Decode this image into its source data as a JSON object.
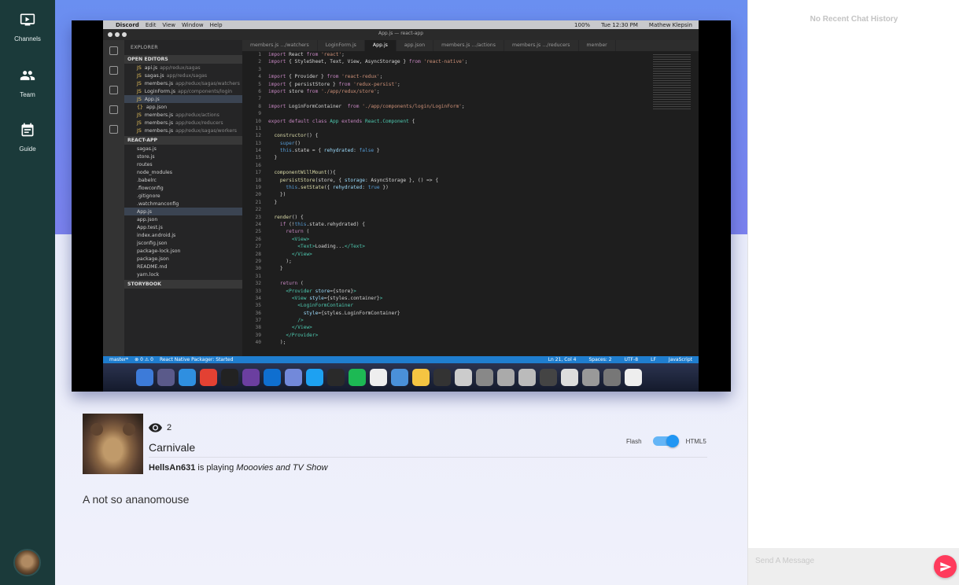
{
  "nav": {
    "items": [
      {
        "label": "Channels",
        "icon": "tv-icon"
      },
      {
        "label": "Team",
        "icon": "people-icon"
      },
      {
        "label": "Guide",
        "icon": "calendar-icon"
      }
    ]
  },
  "stream": {
    "screen": {
      "menubar": {
        "app": "Discord",
        "menus": [
          "Edit",
          "View",
          "Window",
          "Help"
        ],
        "battery": "100%",
        "clock": "Tue 12:30 PM",
        "user": "Mathew Klepsin"
      },
      "window_title": "App.js — react-app",
      "explorer_title": "EXPLORER",
      "open_editors_label": "OPEN EDITORS",
      "open_editors": [
        {
          "name": "api.js",
          "path": "app/redux/sagas"
        },
        {
          "name": "sagas.js",
          "path": "app/redux/sagas"
        },
        {
          "name": "members.js",
          "path": "app/redux/sagas/watchers"
        },
        {
          "name": "LoginForm.js",
          "path": "app/components/login"
        },
        {
          "name": "App.js",
          "path": ""
        },
        {
          "name": "app.json",
          "path": ""
        },
        {
          "name": "members.js",
          "path": "app/redux/actions"
        },
        {
          "name": "members.js",
          "path": "app/redux/reducers"
        },
        {
          "name": "members.js",
          "path": "app/redux/sagas/workers"
        }
      ],
      "project_label": "REACT-APP",
      "project_files": [
        "sagas.js",
        "store.js",
        "routes",
        "node_modules",
        ".babelrc",
        ".flowconfig",
        ".gitignore",
        ".watchmanconfig",
        "App.js",
        "app.json",
        "App.test.js",
        "index.android.js",
        "jsconfig.json",
        "package-lock.json",
        "package.json",
        "README.md",
        "yarn.lock"
      ],
      "storybook_label": "STORYBOOK",
      "tabs": [
        "members.js …/watchers",
        "LoginForm.js",
        "App.js",
        "app.json",
        "members.js …/actions",
        "members.js …/reducers",
        "member"
      ],
      "status": {
        "branch": "master*",
        "errors": "⊗ 0 ⚠ 0",
        "packager": "React Native Packager: Started",
        "position": "Ln 21, Col 4",
        "spaces": "Spaces: 2",
        "encoding": "UTF-8",
        "eol": "LF",
        "language": "JavaScript"
      }
    },
    "viewer_count": "2",
    "channel_title": "Carnivale",
    "streamer": "HellsAn631",
    "playing_text": "is playing",
    "game": "Mooovies and TV Show",
    "description": "A not so ananomouse",
    "player_toggle": {
      "left_label": "Flash",
      "right_label": "HTML5",
      "selected": "HTML5"
    }
  },
  "chat": {
    "empty_text": "No Recent Chat History",
    "input_placeholder": "Send A Message"
  },
  "colors": {
    "rail": "#1b3a3a",
    "accent": "#2196f3",
    "send": "#ff3b5c",
    "header_gradient_top": "#6a8ff0"
  }
}
